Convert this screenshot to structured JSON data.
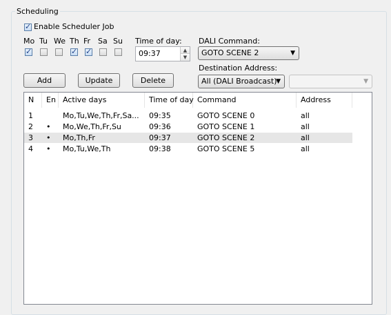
{
  "group_title": "Scheduling",
  "enable_label": "Enable Scheduler Job",
  "enable_checked": true,
  "days": [
    {
      "label": "Mo",
      "checked": true
    },
    {
      "label": "Tu",
      "checked": false
    },
    {
      "label": "We",
      "checked": false
    },
    {
      "label": "Th",
      "checked": true
    },
    {
      "label": "Fr",
      "checked": true
    },
    {
      "label": "Sa",
      "checked": false
    },
    {
      "label": "Su",
      "checked": false
    }
  ],
  "time_label": "Time of day:",
  "time_value": "09:37",
  "dali_label": "DALI Command:",
  "dali_value": "GOTO SCENE 2",
  "dest_label": "Destination Address:",
  "dest_value": "All (DALI Broadcast)",
  "dest_extra_value": "",
  "buttons": {
    "add": "Add",
    "update": "Update",
    "delete": "Delete"
  },
  "columns": [
    "N",
    "En",
    "Active days",
    "Time of day",
    "Command",
    "Address"
  ],
  "rows": [
    {
      "n": "1",
      "en": "",
      "days": "Mo,Tu,We,Th,Fr,Sa...",
      "time": "09:35",
      "command": "GOTO SCENE 0",
      "address": "all"
    },
    {
      "n": "2",
      "en": "•",
      "days": "Mo,We,Th,Fr,Su",
      "time": "09:36",
      "command": "GOTO SCENE 1",
      "address": "all"
    },
    {
      "n": "3",
      "en": "•",
      "days": "Mo,Th,Fr",
      "time": "09:37",
      "command": "GOTO SCENE 2",
      "address": "all"
    },
    {
      "n": "4",
      "en": "•",
      "days": "Mo,Tu,We,Th",
      "time": "09:38",
      "command": "GOTO SCENE 5",
      "address": "all"
    }
  ],
  "selected_row": 2
}
